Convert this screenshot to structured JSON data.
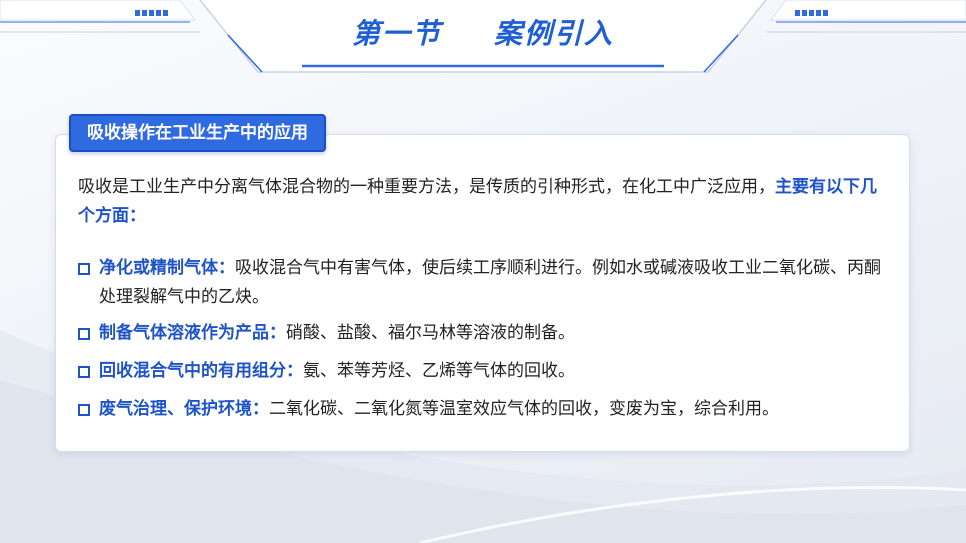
{
  "header": {
    "title_part1": "第一节",
    "title_part2": "案例引入"
  },
  "section": {
    "tag": "吸收操作在工业生产中的应用",
    "intro_text": "吸收是工业生产中分离气体混合物的一种重要方法，是传质的引种形式，在化工中广泛应用，",
    "intro_highlight": "主要有以下几个方面："
  },
  "items": [
    {
      "title": "净化或精制气体：",
      "text": "吸收混合气中有害气体，使后续工序顺利进行。例如水或碱液吸收工业二氧化碳、丙酮处理裂解气中的乙炔。"
    },
    {
      "title": "制备气体溶液作为产品：",
      "text": "硝酸、盐酸、福尔马林等溶液的制备。"
    },
    {
      "title": "回收混合气中的有用组分：",
      "text": "氨、苯等芳烃、乙烯等气体的回收。"
    },
    {
      "title": "废气治理、保护环境：",
      "text": "二氧化碳、二氧化氮等温室效应气体的回收，变废为宝，综合利用。"
    }
  ],
  "colors": {
    "accent": "#1f54c9",
    "tag_bg": "#2f6ae0",
    "title": "#1f5fd6"
  }
}
